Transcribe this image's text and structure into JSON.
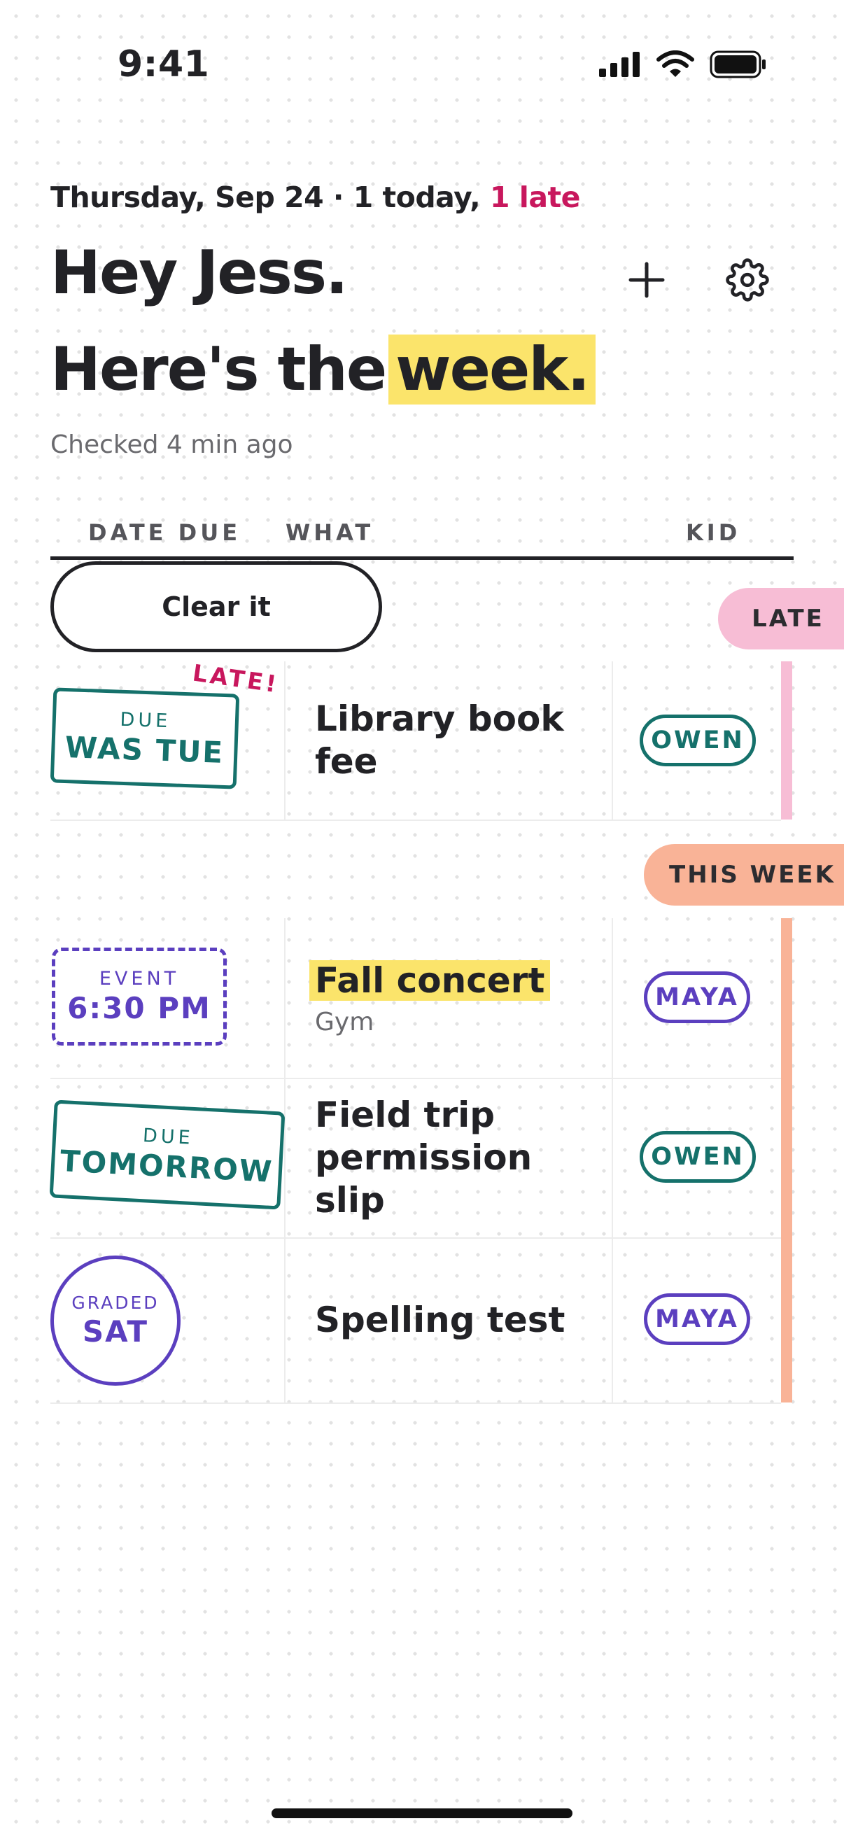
{
  "status_bar": {
    "time": "9:41"
  },
  "header": {
    "date_line": "Thursday, Sep 24 · 1 today, ",
    "late_count": "1 late",
    "greeting": "Hey Jess.",
    "title_start": "Here's the",
    "title_highlight": "week.",
    "checked": "Checked 4 min ago"
  },
  "columns": {
    "date": "DATE DUE",
    "what": "WHAT",
    "kid": "KID"
  },
  "clear_button": "Clear it",
  "sections": {
    "late": {
      "label": "LATE",
      "color": "#f7bdd5",
      "items": [
        {
          "stamp_top": "DUE",
          "stamp_main": "WAS TUE",
          "late_tag": "LATE!",
          "title": "Library book fee",
          "kid": "OWEN"
        }
      ]
    },
    "this_week": {
      "label": "THIS WEEK",
      "color": "#f9b397",
      "items": [
        {
          "stamp_top": "EVENT",
          "stamp_main": "6:30 PM",
          "title": "Fall concert",
          "subtitle": "Gym",
          "kid": "MAYA"
        },
        {
          "stamp_top": "DUE",
          "stamp_main": "TOMORROW",
          "title": "Field trip permission slip",
          "kid": "OWEN"
        },
        {
          "stamp_top": "GRADED",
          "stamp_main": "SAT",
          "title": "Spelling test",
          "kid": "MAYA"
        }
      ]
    }
  },
  "colors": {
    "late_red": "#c8175d",
    "highlight": "#fbe46b",
    "teal": "#15716b",
    "purple": "#5b3fbf"
  },
  "icons": [
    "cellular-signal-icon",
    "wifi-icon",
    "battery-icon",
    "plus-icon",
    "gear-icon"
  ]
}
